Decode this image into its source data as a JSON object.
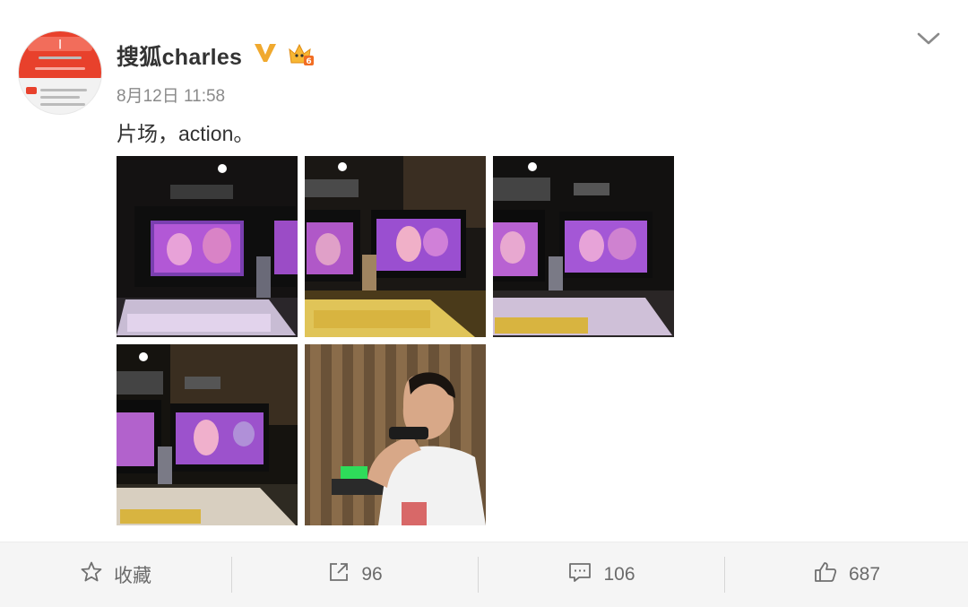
{
  "post": {
    "username": "搜狐charles",
    "level": "6",
    "timestamp": "8月12日 11:58",
    "text": "片场，action。",
    "photos": [
      {
        "name": "photo-monitor-1"
      },
      {
        "name": "photo-monitor-2"
      },
      {
        "name": "photo-monitor-3"
      },
      {
        "name": "photo-monitor-4"
      },
      {
        "name": "photo-director-walkie-talkie"
      }
    ]
  },
  "toolbar": {
    "favorite_label": "收藏",
    "repost_count": "96",
    "comment_count": "106",
    "like_count": "687"
  },
  "colors": {
    "verified_gold": "#f0a92e",
    "text_gray": "#8a8a8a",
    "toolbar_bg": "#f5f5f5"
  },
  "icons": [
    "verified-v-icon",
    "level-crown-icon",
    "chevron-down-icon",
    "star-icon",
    "repost-icon",
    "comment-icon",
    "thumbs-up-icon"
  ]
}
